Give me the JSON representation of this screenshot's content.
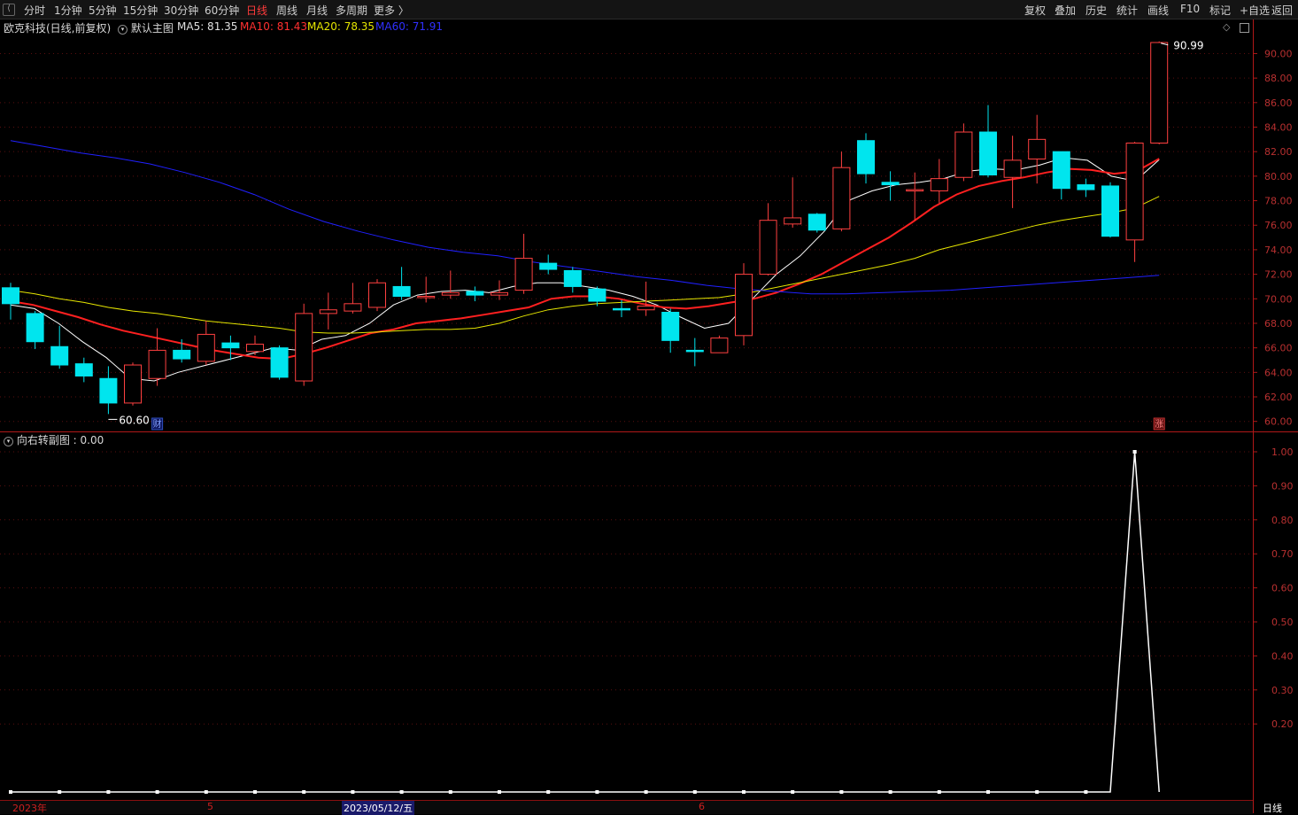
{
  "toolbar": {
    "left": [
      "分时",
      "1分钟",
      "5分钟",
      "15分钟",
      "30分钟",
      "60分钟",
      "日线",
      "周线",
      "月线",
      "多周期",
      "更多 〉"
    ],
    "active": "日线",
    "right": [
      "复权",
      "叠加",
      "历史",
      "统计",
      "画线",
      "F10",
      "标记",
      "+自选",
      "返回"
    ]
  },
  "main_legend": {
    "stock": "欧克科技(日线,前复权)",
    "chart": "默认主图",
    "ma5": "MA5: 81.35",
    "ma10": "MA10: 81.43",
    "ma20": "MA20: 78.35",
    "ma60": "MA60: 71.91"
  },
  "sub_legend": {
    "title": "向右转副图 : 0.00"
  },
  "annotations": {
    "high": "90.99",
    "low": "60.60",
    "cai": "财",
    "zhang": "涨"
  },
  "x_labels": {
    "year": "2023年",
    "may": "5",
    "selected_date": "2023/05/12/五",
    "jun": "6"
  },
  "period_label": "日线",
  "colors": {
    "up": "#ff4040",
    "down": "#00e5ee",
    "ma5": "#ffffff",
    "ma10": "#ff2020",
    "ma20": "#e6e600",
    "ma60": "#2020ff",
    "axis": "#b01818"
  },
  "chart_data": [
    {
      "type": "candlestick",
      "title": "欧克科技(日线,前复权)",
      "y_ticks": [
        "90.00",
        "88.00",
        "86.00",
        "84.00",
        "82.00",
        "80.00",
        "78.00",
        "76.00",
        "74.00",
        "72.00",
        "70.00",
        "68.00",
        "66.00",
        "64.00",
        "62.00",
        "60.00"
      ],
      "ylim": [
        59.4,
        92.2
      ],
      "candles": [
        {
          "o": 70.9,
          "c": 69.6,
          "h": 71.3,
          "l": 68.3
        },
        {
          "o": 68.8,
          "c": 66.5,
          "h": 69.0,
          "l": 65.9
        },
        {
          "o": 66.1,
          "c": 64.6,
          "h": 67.8,
          "l": 64.3
        },
        {
          "o": 64.7,
          "c": 63.7,
          "h": 65.2,
          "l": 63.2
        },
        {
          "o": 63.5,
          "c": 61.5,
          "h": 64.5,
          "l": 60.6
        },
        {
          "o": 61.5,
          "c": 64.6,
          "h": 64.8,
          "l": 61.3
        },
        {
          "o": 63.5,
          "c": 65.8,
          "h": 67.6,
          "l": 62.9
        },
        {
          "o": 65.8,
          "c": 65.1,
          "h": 66.7,
          "l": 64.8
        },
        {
          "o": 64.9,
          "c": 67.1,
          "h": 68.2,
          "l": 64.6
        },
        {
          "o": 66.4,
          "c": 66.0,
          "h": 67.0,
          "l": 65.0
        },
        {
          "o": 65.7,
          "c": 66.3,
          "h": 67.0,
          "l": 65.4
        },
        {
          "o": 66.0,
          "c": 63.6,
          "h": 66.2,
          "l": 63.4
        },
        {
          "o": 63.3,
          "c": 68.8,
          "h": 69.6,
          "l": 62.9
        },
        {
          "o": 68.8,
          "c": 69.1,
          "h": 70.5,
          "l": 67.5
        },
        {
          "o": 69.0,
          "c": 69.6,
          "h": 71.3,
          "l": 68.8
        },
        {
          "o": 69.3,
          "c": 71.3,
          "h": 71.6,
          "l": 69.0
        },
        {
          "o": 71.0,
          "c": 70.2,
          "h": 72.6,
          "l": 69.9
        },
        {
          "o": 70.1,
          "c": 70.2,
          "h": 71.8,
          "l": 69.7
        },
        {
          "o": 70.3,
          "c": 70.5,
          "h": 72.3,
          "l": 70.0
        },
        {
          "o": 70.6,
          "c": 70.3,
          "h": 71.0,
          "l": 69.8
        },
        {
          "o": 70.3,
          "c": 70.5,
          "h": 71.5,
          "l": 69.9
        },
        {
          "o": 70.7,
          "c": 73.3,
          "h": 75.3,
          "l": 70.4
        },
        {
          "o": 72.9,
          "c": 72.4,
          "h": 73.6,
          "l": 72.0
        },
        {
          "o": 72.3,
          "c": 71.0,
          "h": 72.6,
          "l": 70.5
        },
        {
          "o": 70.8,
          "c": 69.8,
          "h": 71.0,
          "l": 69.4
        },
        {
          "o": 69.2,
          "c": 69.1,
          "h": 69.9,
          "l": 68.5
        },
        {
          "o": 69.1,
          "c": 69.4,
          "h": 71.4,
          "l": 68.6
        },
        {
          "o": 68.9,
          "c": 66.6,
          "h": 69.2,
          "l": 65.6
        },
        {
          "o": 65.8,
          "c": 65.7,
          "h": 66.8,
          "l": 64.5
        },
        {
          "o": 65.6,
          "c": 66.8,
          "h": 67.0,
          "l": 65.6
        },
        {
          "o": 67.0,
          "c": 72.0,
          "h": 72.9,
          "l": 66.2
        },
        {
          "o": 72.0,
          "c": 76.4,
          "h": 77.8,
          "l": 71.9
        },
        {
          "o": 76.1,
          "c": 76.6,
          "h": 79.9,
          "l": 75.8
        },
        {
          "o": 76.9,
          "c": 75.6,
          "h": 77.0,
          "l": 75.4
        },
        {
          "o": 75.7,
          "c": 80.7,
          "h": 82.0,
          "l": 75.5
        },
        {
          "o": 82.9,
          "c": 80.2,
          "h": 83.5,
          "l": 79.4
        },
        {
          "o": 79.5,
          "c": 79.3,
          "h": 80.4,
          "l": 78.0
        },
        {
          "o": 78.8,
          "c": 78.9,
          "h": 80.3,
          "l": 76.4
        },
        {
          "o": 78.8,
          "c": 79.8,
          "h": 81.4,
          "l": 77.8
        },
        {
          "o": 79.9,
          "c": 83.6,
          "h": 84.3,
          "l": 79.6
        },
        {
          "o": 83.6,
          "c": 80.1,
          "h": 85.8,
          "l": 79.9
        },
        {
          "o": 79.9,
          "c": 81.3,
          "h": 83.3,
          "l": 77.4
        },
        {
          "o": 81.4,
          "c": 83.0,
          "h": 85.0,
          "l": 79.4
        },
        {
          "o": 82.0,
          "c": 79.0,
          "h": 82.0,
          "l": 78.1
        },
        {
          "o": 79.3,
          "c": 78.9,
          "h": 79.8,
          "l": 78.3
        },
        {
          "o": 79.2,
          "c": 75.1,
          "h": 79.5,
          "l": 75.0
        },
        {
          "o": 74.8,
          "c": 82.7,
          "h": 82.8,
          "l": 73.0
        },
        {
          "o": 82.7,
          "c": 90.9,
          "h": 90.99,
          "l": 82.6
        }
      ],
      "series": [
        {
          "name": "MA5",
          "values": [
            69.5,
            69.2,
            68.0,
            66.5,
            65.2,
            63.5,
            63.3,
            64.0,
            64.5,
            65.0,
            65.5,
            66.0,
            65.8,
            66.7,
            67.0,
            68.0,
            69.5,
            70.3,
            70.6,
            70.7,
            70.5,
            71.0,
            71.3,
            71.3,
            71.0,
            70.7,
            70.2,
            69.5,
            68.5,
            67.6,
            68.0,
            70.0,
            72.0,
            73.5,
            75.5,
            78.0,
            78.8,
            79.3,
            79.5,
            79.8,
            80.4,
            80.6,
            80.5,
            80.9,
            81.5,
            81.3,
            80.0,
            79.6,
            81.35
          ]
        },
        {
          "name": "MA10",
          "values": [
            69.8,
            69.5,
            69.0,
            68.5,
            67.9,
            67.4,
            67.0,
            66.6,
            66.2,
            65.8,
            65.5,
            65.2,
            65.1,
            65.5,
            66.0,
            66.6,
            67.2,
            67.5,
            68.0,
            68.2,
            68.4,
            68.7,
            69.0,
            69.3,
            70.0,
            70.2,
            70.2,
            70.0,
            69.6,
            69.3,
            69.2,
            69.4,
            69.7,
            70.0,
            70.5,
            71.2,
            72.0,
            73.0,
            74.0,
            75.0,
            76.2,
            77.5,
            78.5,
            79.2,
            79.6,
            79.9,
            80.3,
            80.6,
            80.5,
            80.2,
            80.4,
            81.43
          ]
        },
        {
          "name": "MA20",
          "values": [
            70.7,
            70.4,
            70.0,
            69.7,
            69.3,
            69.0,
            68.8,
            68.5,
            68.2,
            68.0,
            67.8,
            67.6,
            67.3,
            67.2,
            67.2,
            67.3,
            67.4,
            67.5,
            67.5,
            67.6,
            68.0,
            68.6,
            69.1,
            69.4,
            69.6,
            69.7,
            69.8,
            69.9,
            70.0,
            70.1,
            70.4,
            70.8,
            71.2,
            71.6,
            72.0,
            72.4,
            72.8,
            73.3,
            74.0,
            74.5,
            75.0,
            75.5,
            76.0,
            76.4,
            76.7,
            77.0,
            77.4,
            78.35
          ]
        },
        {
          "name": "MA60",
          "values": [
            82.9,
            82.4,
            81.9,
            81.5,
            81.0,
            80.3,
            79.5,
            78.5,
            77.3,
            76.3,
            75.5,
            74.8,
            74.2,
            73.8,
            73.5,
            73.0,
            72.6,
            72.2,
            71.8,
            71.5,
            71.1,
            70.8,
            70.6,
            70.4,
            70.4,
            70.5,
            70.6,
            70.7,
            70.9,
            71.1,
            71.3,
            71.5,
            71.7,
            71.91
          ]
        }
      ]
    },
    {
      "type": "line",
      "title": "向右转副图",
      "y_ticks": [
        "1.00",
        "0.90",
        "0.80",
        "0.70",
        "0.60",
        "0.50",
        "0.40",
        "0.30",
        "0.20"
      ],
      "ylim": [
        0,
        1
      ],
      "series": [
        {
          "name": "向右转副图",
          "values": [
            0,
            0,
            0,
            0,
            0,
            0,
            0,
            0,
            0,
            0,
            0,
            0,
            0,
            0,
            0,
            0,
            0,
            0,
            0,
            0,
            0,
            0,
            0,
            0,
            0,
            0,
            0,
            0,
            0,
            0,
            0,
            0,
            0,
            0,
            0,
            0,
            0,
            0,
            0,
            0,
            0,
            0,
            0,
            0,
            0,
            0,
            1,
            0
          ]
        }
      ]
    }
  ]
}
